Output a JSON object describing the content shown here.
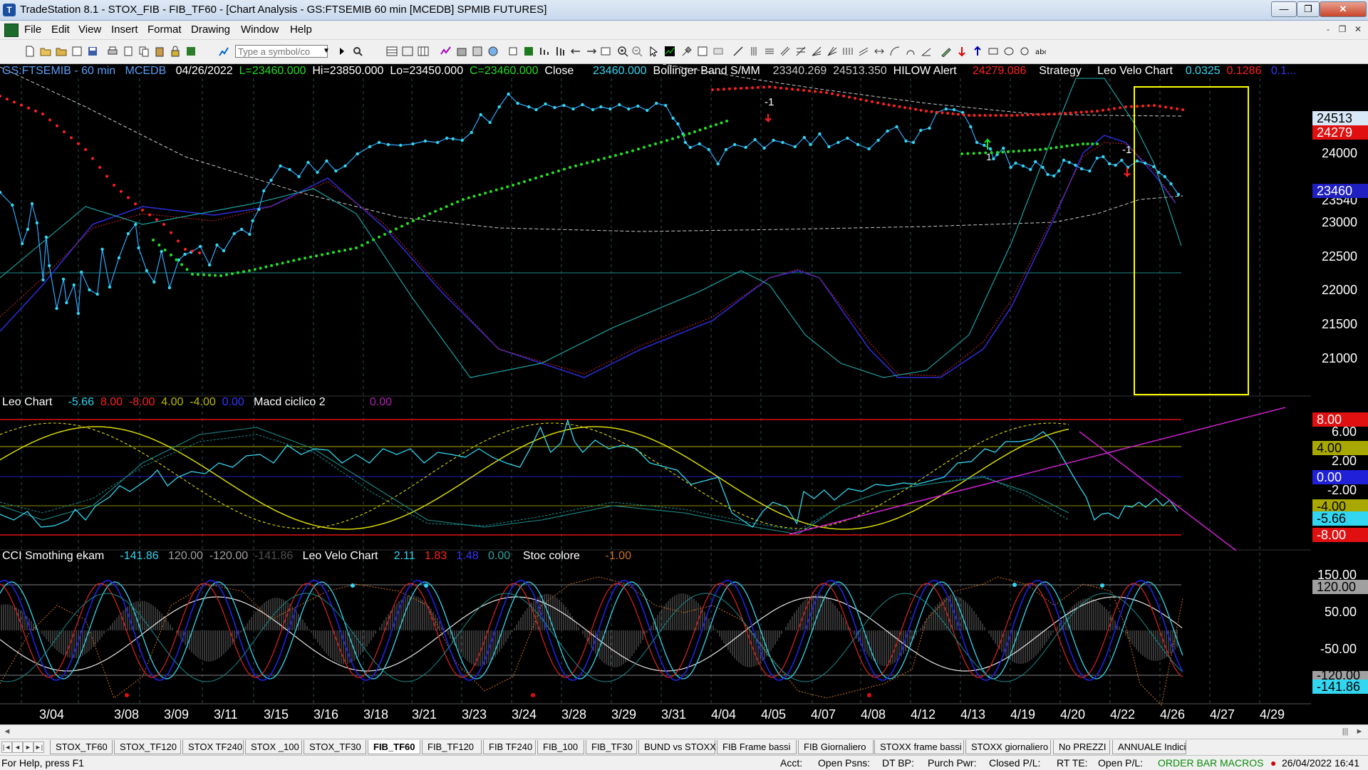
{
  "window": {
    "title": "TradeStation 8.1 - STOX_FIB - FIB_TF60 - [Chart Analysis - GS:FTSEMIB  60 min  [MCEDB] SPMIB FUTURES]",
    "minimize": "—",
    "maximize": "❐",
    "close": "✕"
  },
  "menu": {
    "items": [
      "File",
      "Edit",
      "View",
      "Insert",
      "Format",
      "Drawing",
      "Window",
      "Help"
    ],
    "mdi": [
      "-",
      "❐",
      "✕"
    ]
  },
  "toolbar": {
    "symbol_placeholder": "Type a symbol/co"
  },
  "panel1": {
    "symbol": "GS:FTSEMIB - 60 min",
    "exchange": "MCEDB",
    "date": "04/26/2022",
    "last": "L=23460.000",
    "high": "Hi=23850.000",
    "low": "Lo=23450.000",
    "close": "C=23460.000",
    "close_label": "Close",
    "close_value": "23460.000",
    "bb_label": "Bollinger Band S/MM",
    "bb_lower": "23340.269",
    "bb_upper": "24513.350",
    "hilow_label": "HILOW Alert",
    "hilow_value": "24279.086",
    "strategy": "Strategy",
    "leo_velo": "Leo Velo Chart",
    "v1": "0.0325",
    "v2": "0.1286",
    "v3": "0.1...",
    "axis": [
      "24000",
      "23000",
      "22500",
      "22000",
      "21500",
      "21000"
    ],
    "axis_23500": "23540",
    "boxes": {
      "bb_upper": "24513",
      "hilow": "24279",
      "price": "23460"
    },
    "marker_top": "-1",
    "marker_mid": "-1",
    "marker_low": "1"
  },
  "panel2": {
    "name": "Leo Chart",
    "v1": "-5.66",
    "v2": "8.00",
    "v3": "-8.00",
    "v4": "4.00",
    "v5": "-4.00",
    "v6": "0.00",
    "macd": "Macd ciclico 2",
    "macd_v": "0.00",
    "axis": [
      "6.00",
      "2.00",
      "-2.00"
    ],
    "boxes": {
      "p8": "8.00",
      "p4": "4.00",
      "zero": "0.00",
      "m4": "-4.00",
      "m566": "-5.66",
      "m8": "-8.00"
    }
  },
  "panel3": {
    "name": "CCI Smothing ekam",
    "v1": "-141.86",
    "v2": "120.00",
    "v3": "-120.00",
    "v4": "-141.86",
    "leo_velo": "Leo Velo Chart",
    "lv1": "2.11",
    "lv2": "1.83",
    "lv3": "1.48",
    "lv4": "0.00",
    "stoc": "Stoc colore",
    "stoc_v": "-1.00",
    "axis": [
      "150.00",
      "50.00",
      "-50.00"
    ],
    "boxes": {
      "p120": "120.00",
      "m120": "-120.00",
      "m14186": "-141.86"
    }
  },
  "dates": [
    "3/04",
    "3/08",
    "3/09",
    "3/11",
    "3/15",
    "3/16",
    "3/18",
    "3/21",
    "3/23",
    "3/24",
    "3/28",
    "3/29",
    "3/31",
    "4/04",
    "4/05",
    "4/07",
    "4/08",
    "4/12",
    "4/13",
    "4/19",
    "4/20",
    "4/22",
    "4/26",
    "4/27",
    "4/29"
  ],
  "tabs": [
    "STOX_TF60",
    "STOX_TF120",
    "STOX TF240",
    "STOX _100",
    "STOX_TF30",
    "FIB_TF60",
    "FIB_TF120",
    "FIB TF240",
    "FIB_100",
    "FIB_TF30",
    "BUND vs STOXX",
    "FIB Frame bassi",
    "FIB Giornaliero",
    "STOXX frame bassi",
    "STOXX giornaliero",
    "No PREZZI",
    "ANNUALE Indici"
  ],
  "active_tab": "FIB_TF60",
  "status": {
    "help": "For Help, press F1",
    "acct": "Acct:",
    "open_psns": "Open Psns:",
    "dt_bp": "DT BP:",
    "purch_pwr": "Purch Pwr:",
    "closed_pl": "Closed P/L:",
    "rt_te": "RT TE:",
    "open_pl": "Open P/L:",
    "order_bar": "ORDER BAR",
    "macros": "MACROS",
    "datetime": "26/04/2022 16:41"
  },
  "colors": {
    "price": "#33d6f0",
    "red_dots": "#ff1e1e",
    "green_dots": "#22e022",
    "yellow_box": "#ffff00",
    "magenta": "#d020d0",
    "bb": "#c8c8c8"
  }
}
